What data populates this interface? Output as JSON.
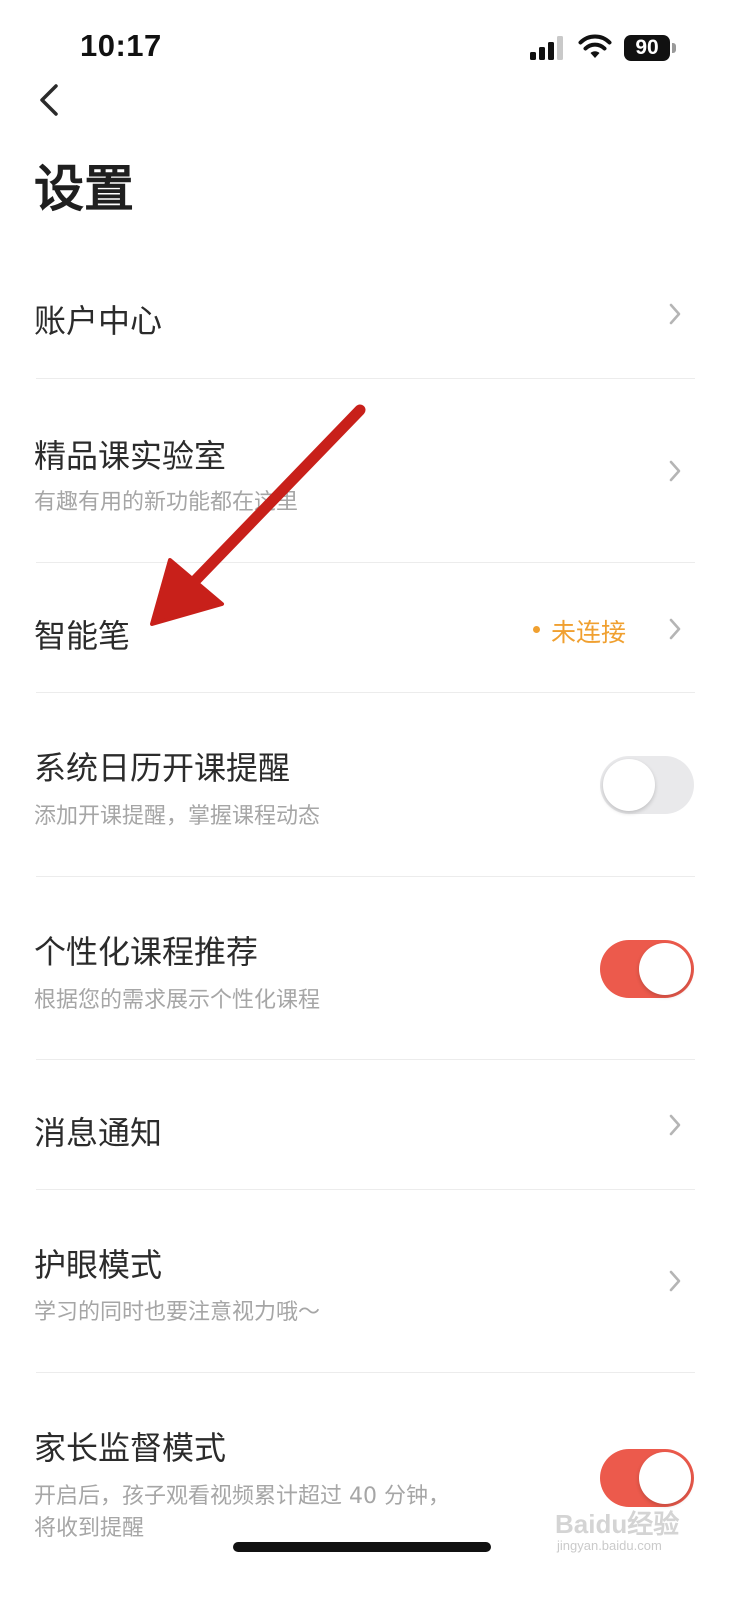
{
  "status_bar": {
    "time": "10:17",
    "battery_percent": "90",
    "icons": [
      "signal-icon",
      "wifi-icon",
      "battery-icon"
    ]
  },
  "header": {
    "back_icon": "chevron-left-icon",
    "title": "设置"
  },
  "settings": {
    "account_center": {
      "title": "账户中心",
      "control": "chevron"
    },
    "lab": {
      "title": "精品课实验室",
      "subtitle": "有趣有用的新功能都在这里",
      "control": "chevron"
    },
    "smart_pen": {
      "title": "智能笔",
      "status": "未连接",
      "control": "chevron"
    },
    "calendar_reminder": {
      "title": "系统日历开课提醒",
      "subtitle": "添加开课提醒，掌握课程动态",
      "control": "toggle",
      "enabled": false
    },
    "personalized": {
      "title": "个性化课程推荐",
      "subtitle": "根据您的需求展示个性化课程",
      "control": "toggle",
      "enabled": true
    },
    "notifications": {
      "title": "消息通知",
      "control": "chevron"
    },
    "eye_care": {
      "title": "护眼模式",
      "subtitle": "学习的同时也要注意视力哦～",
      "control": "chevron"
    },
    "parental": {
      "title": "家长监督模式",
      "subtitle_line1": "开启后，孩子观看视频累计超过 40 分钟，",
      "subtitle_line2": "将收到提醒",
      "control": "toggle",
      "enabled": true
    }
  },
  "colors": {
    "accent_red": "#ec5a4c",
    "status_orange": "#f0a030",
    "annotation_arrow": "#c8201a"
  },
  "watermark": {
    "text": "Baidu经验",
    "sub": "jingyan.baidu.com"
  }
}
